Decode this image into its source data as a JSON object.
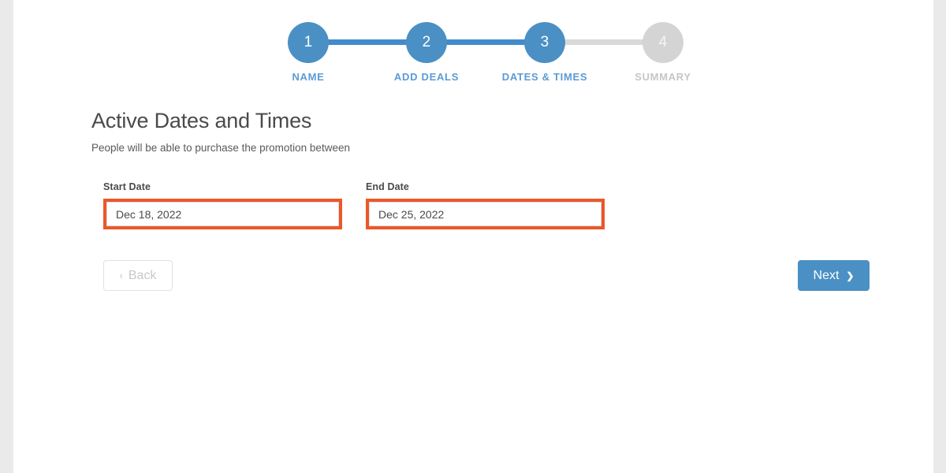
{
  "theme": {
    "accent_blue": "#4a90c4",
    "label_blue": "#5b9bd5",
    "inactive_grey": "#d4d4d4",
    "highlight_orange": "#ed5728",
    "page_background": "#ffffff",
    "gutter_grey": "#eaeaea"
  },
  "stepper": {
    "steps": [
      {
        "number": "1",
        "label": "NAME",
        "state": "active"
      },
      {
        "number": "2",
        "label": "ADD DEALS",
        "state": "active"
      },
      {
        "number": "3",
        "label": "DATES & TIMES",
        "state": "active"
      },
      {
        "number": "4",
        "label": "SUMMARY",
        "state": "inactive"
      }
    ]
  },
  "main": {
    "title": "Active Dates and Times",
    "subtitle": "People will be able to purchase the promotion between",
    "fields": {
      "start": {
        "label": "Start Date",
        "value": "Dec 18, 2022",
        "placeholder": "Start Date",
        "highlighted": true
      },
      "end": {
        "label": "End Date",
        "value": "Dec 25, 2022",
        "placeholder": "End Date",
        "highlighted": true
      }
    }
  },
  "nav": {
    "back_label": "Back",
    "back_icon": "chevron-left-icon",
    "back_glyph": "‹",
    "next_label": "Next",
    "next_icon": "chevron-right-icon",
    "next_glyph": "❯"
  }
}
